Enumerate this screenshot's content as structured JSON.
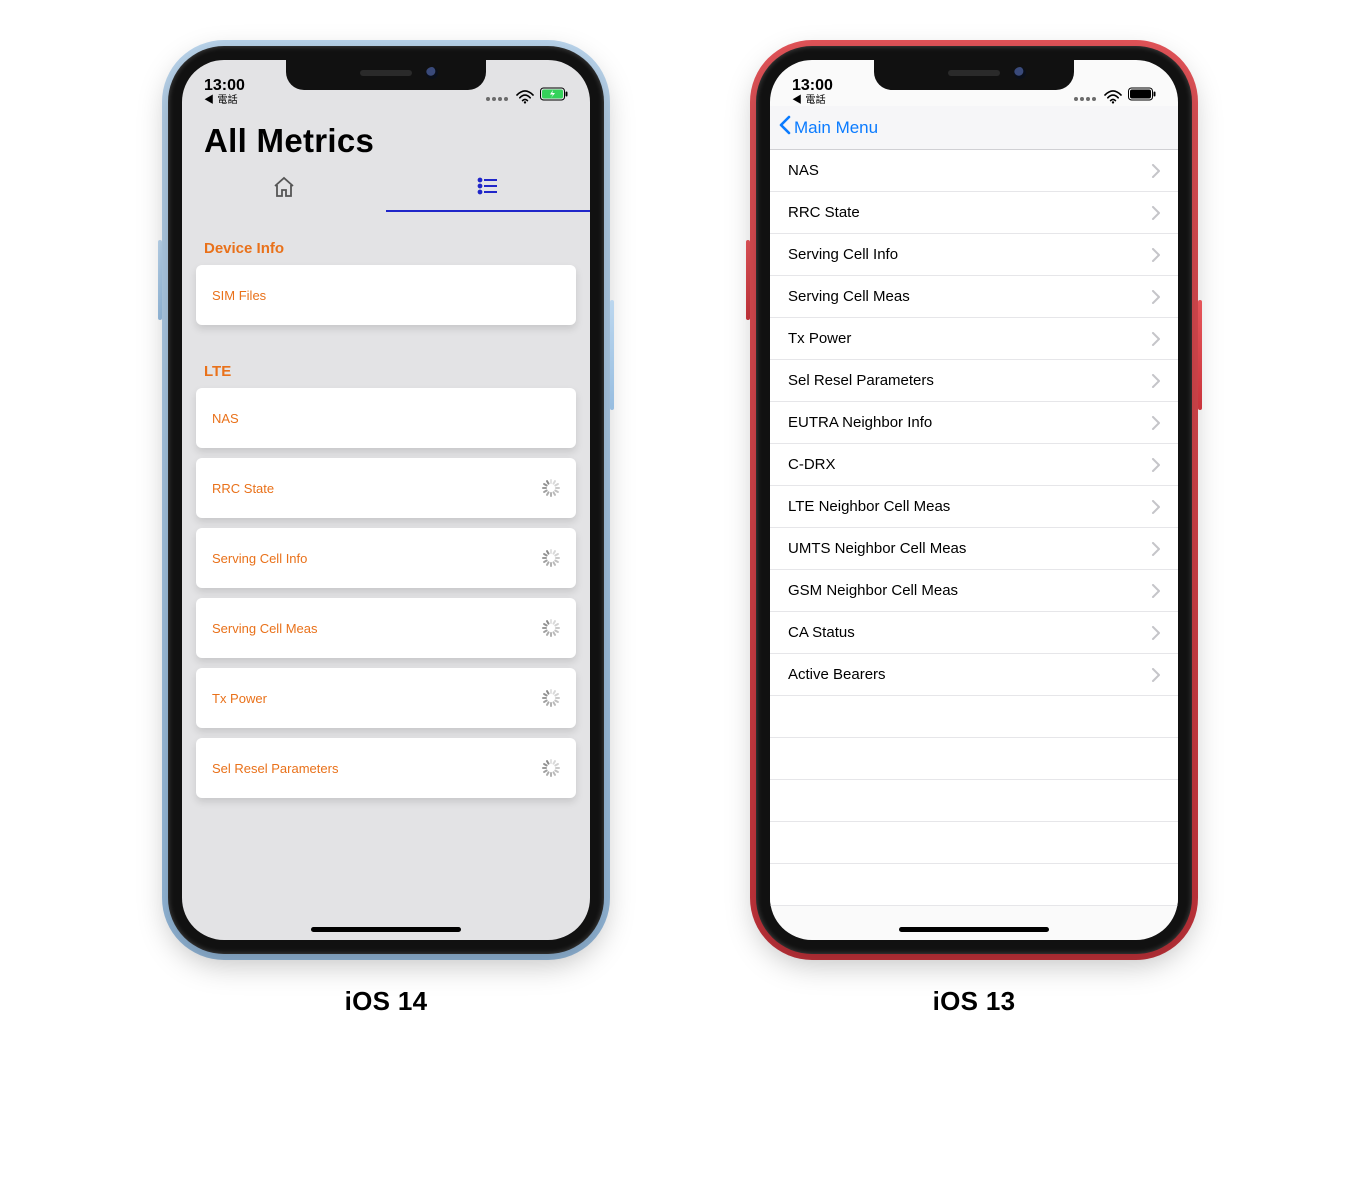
{
  "statusbar": {
    "time": "13:00",
    "back_app_hint": "◀ 電話"
  },
  "ios14": {
    "title": "All Metrics",
    "sections": [
      {
        "label": "Device Info",
        "items": [
          {
            "label": "SIM Files",
            "loading": false
          }
        ]
      },
      {
        "label": "LTE",
        "items": [
          {
            "label": "NAS",
            "loading": false
          },
          {
            "label": "RRC State",
            "loading": true
          },
          {
            "label": "Serving Cell Info",
            "loading": true
          },
          {
            "label": "Serving Cell Meas",
            "loading": true
          },
          {
            "label": "Tx Power",
            "loading": true
          },
          {
            "label": "Sel Resel Parameters",
            "loading": true
          }
        ]
      }
    ],
    "caption": "iOS 14"
  },
  "ios13": {
    "back_label": "Main Menu",
    "items": [
      "NAS",
      "RRC State",
      "Serving Cell Info",
      "Serving Cell Meas",
      "Tx Power",
      "Sel Resel Parameters",
      "EUTRA Neighbor Info",
      "C-DRX",
      "LTE Neighbor Cell Meas",
      "UMTS Neighbor Cell Meas",
      "GSM Neighbor Cell Meas",
      "CA Status",
      "Active Bearers"
    ],
    "caption": "iOS 13"
  },
  "colors": {
    "accent_orange": "#e9711a",
    "tab_indicator": "#2026c9",
    "ios_link_blue": "#0a7bff"
  }
}
